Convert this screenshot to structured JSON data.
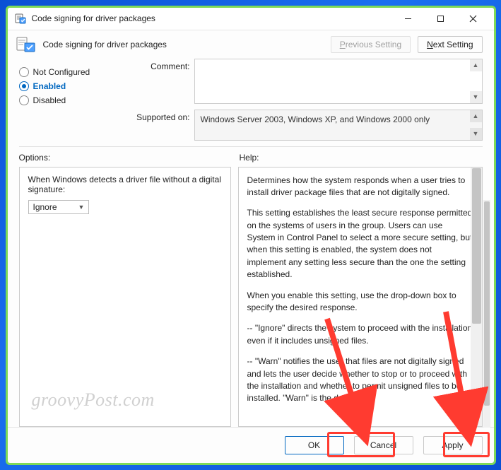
{
  "titlebar": {
    "title": "Code signing for driver packages"
  },
  "subheader": {
    "subtitle": "Code signing for driver packages",
    "prev": "Previous Setting",
    "next": "Next Setting"
  },
  "radios": {
    "not_configured": "Not Configured",
    "enabled": "Enabled",
    "disabled": "Disabled",
    "selected": "enabled"
  },
  "meta": {
    "comment_label": "Comment:",
    "comment_value": "",
    "supported_label": "Supported on:",
    "supported_value": "Windows Server 2003, Windows XP, and Windows 2000 only"
  },
  "labels": {
    "options": "Options:",
    "help": "Help:"
  },
  "options": {
    "prompt": "When Windows detects a driver file without a digital signature:",
    "dropdown_value": "Ignore"
  },
  "help": {
    "p1": "Determines how the system responds when a user tries to install driver package files that are not digitally signed.",
    "p2": "This setting establishes the least secure response permitted on the systems of users in the group. Users can use System in Control Panel to select a more secure setting, but when this setting is enabled, the system does not implement any setting less secure than the one the setting established.",
    "p3": "When you enable this setting, use the drop-down box to specify the desired response.",
    "p4": "--   \"Ignore\" directs the system to proceed with the installation even if it includes unsigned files.",
    "p5": "--   \"Warn\" notifies the user that files are not digitally signed and lets the user decide whether to stop or to proceed with the installation and whether to permit unsigned files to be installed. \"Warn\" is the default."
  },
  "footer": {
    "ok": "OK",
    "cancel": "Cancel",
    "apply": "Apply"
  },
  "watermark": "groovyPost.com"
}
